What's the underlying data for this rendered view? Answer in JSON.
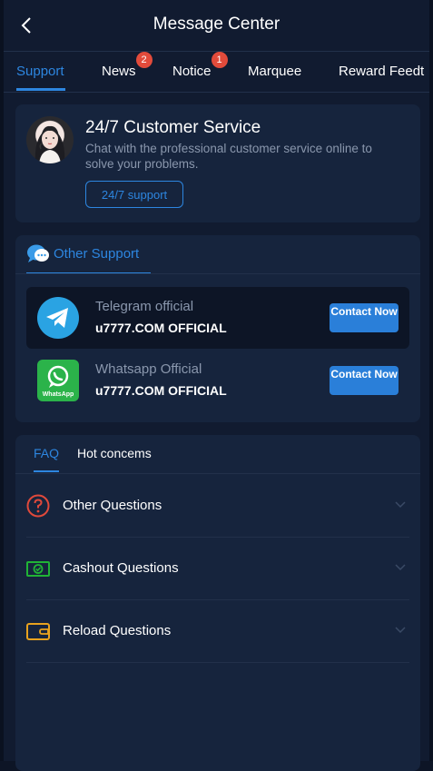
{
  "header": {
    "title": "Message Center",
    "back_icon": "chevron-left-icon"
  },
  "tabs": [
    {
      "label": "Support",
      "active": true
    },
    {
      "label": "News",
      "badge": "2"
    },
    {
      "label": "Notice",
      "badge": "1"
    },
    {
      "label": "Marquee"
    },
    {
      "label": "Reward Feedt"
    }
  ],
  "customer_service": {
    "title": "24/7 Customer Service",
    "description": "Chat with the professional customer service online to solve your problems.",
    "button_label": "24/7 support"
  },
  "other_support": {
    "tab_label": "Other Support",
    "contacts": [
      {
        "name": "Telegram official",
        "account": "u7777.COM OFFICIAL",
        "button_label": "Contact Now",
        "icon": "telegram-icon"
      },
      {
        "name": "Whatsapp Official",
        "account": "u7777.COM OFFICIAL",
        "button_label": "Contact Now",
        "icon": "whatsapp-icon",
        "icon_text": "WhatsApp"
      }
    ]
  },
  "faq": {
    "tabs": [
      {
        "label": "FAQ",
        "active": true
      },
      {
        "label": "Hot concems"
      }
    ],
    "items": [
      {
        "label": "Other Questions",
        "icon": "question-icon"
      },
      {
        "label": "Cashout Questions",
        "icon": "cash-icon"
      },
      {
        "label": "Reload Questions",
        "icon": "wallet-icon"
      }
    ]
  },
  "colors": {
    "accent": "#2d86e0",
    "background": "#111b30",
    "card": "#16243d",
    "badge": "#e24b3b"
  }
}
